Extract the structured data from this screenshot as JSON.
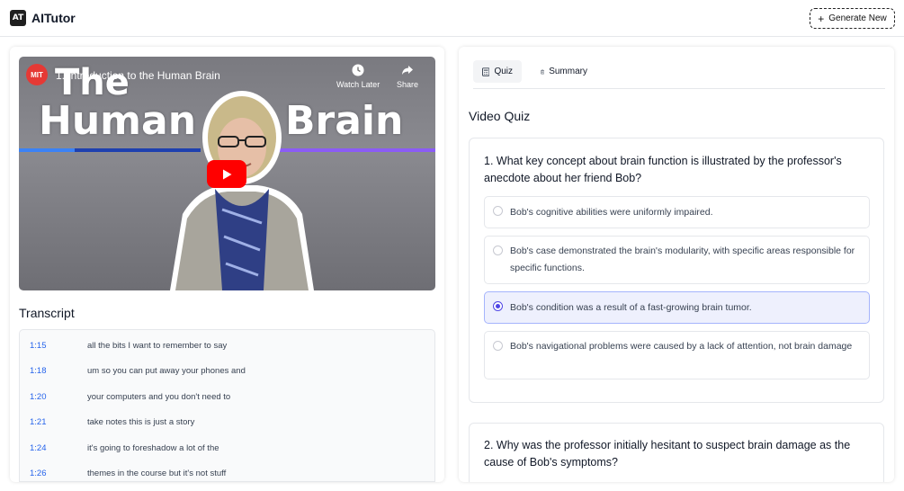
{
  "header": {
    "logo_text": "AT",
    "app_title": "AITutor",
    "generate_button": "Generate New"
  },
  "video": {
    "channel_logo": "MIT",
    "title": "1. Introduction to the Human Brain",
    "thumb_text_line1": "The",
    "thumb_text_line2a": "Human",
    "thumb_text_line2b": "Brain",
    "watch_later": "Watch Later",
    "share": "Share"
  },
  "transcript": {
    "title": "Transcript",
    "rows": [
      {
        "time": "1:15",
        "text": "all the bits I want to remember to say"
      },
      {
        "time": "1:18",
        "text": "um so you can put away your phones and"
      },
      {
        "time": "1:20",
        "text": "your computers and you don't need to"
      },
      {
        "time": "1:21",
        "text": "take notes this is just a story"
      },
      {
        "time": "1:24",
        "text": "it's going to foreshadow a lot of the"
      },
      {
        "time": "1:26",
        "text": "themes in the course but it's not stuff"
      }
    ]
  },
  "tabs": {
    "quiz": "Quiz",
    "summary": "Summary"
  },
  "quiz": {
    "title": "Video Quiz",
    "q1": {
      "text": "1. What key concept about brain function is illustrated by the professor's anecdote about her friend Bob?",
      "options": [
        "Bob's cognitive abilities were uniformly impaired.",
        "Bob's case demonstrated the brain's modularity, with specific areas responsible for specific functions.",
        "Bob's condition was a result of a fast-growing brain tumor.",
        "Bob's navigational problems were caused by a lack of attention, not brain damage"
      ],
      "selected_index": 2
    },
    "q2": {
      "text": "2. Why was the professor initially hesitant to suspect brain damage as the cause of Bob's symptoms?"
    }
  },
  "colors": {
    "accent": "#4f46e5",
    "link": "#2563eb",
    "play": "#ff0000"
  }
}
